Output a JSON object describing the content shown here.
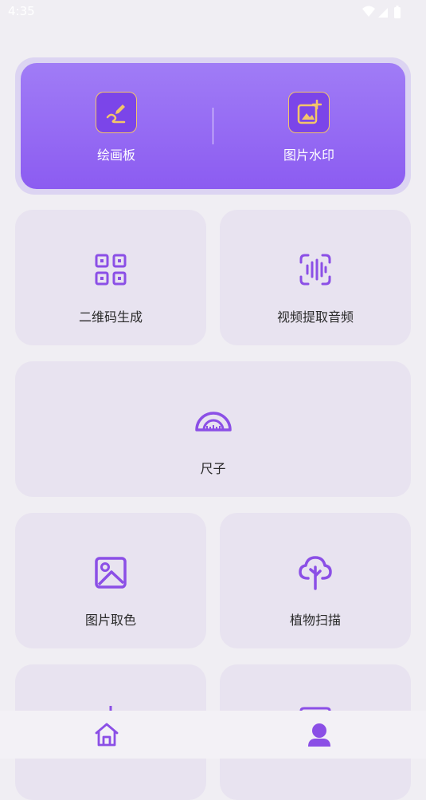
{
  "status_bar": {
    "time": "4:35"
  },
  "hero": {
    "left": {
      "label": "绘画板",
      "icon": "drawing-board-icon"
    },
    "right": {
      "label": "图片水印",
      "icon": "image-watermark-icon"
    }
  },
  "tools": [
    {
      "label": "二维码生成",
      "icon": "qr-code-icon"
    },
    {
      "label": "视频提取音频",
      "icon": "audio-wave-icon"
    },
    {
      "label": "尺子",
      "icon": "protractor-ruler-icon"
    },
    {
      "label": "图片取色",
      "icon": "image-icon"
    },
    {
      "label": "植物扫描",
      "icon": "tree-icon"
    }
  ],
  "bottom_nav": {
    "items": [
      {
        "name": "home",
        "icon": "home-icon",
        "active": true
      },
      {
        "name": "profile",
        "icon": "user-icon",
        "active": false
      }
    ]
  },
  "colors": {
    "accent": "#8c5cf1",
    "icon_purple": "#8b4fe6",
    "card_bg": "#e8e3f0",
    "page_bg": "#f0eef3",
    "hero_icon_border": "#f3c56a"
  }
}
